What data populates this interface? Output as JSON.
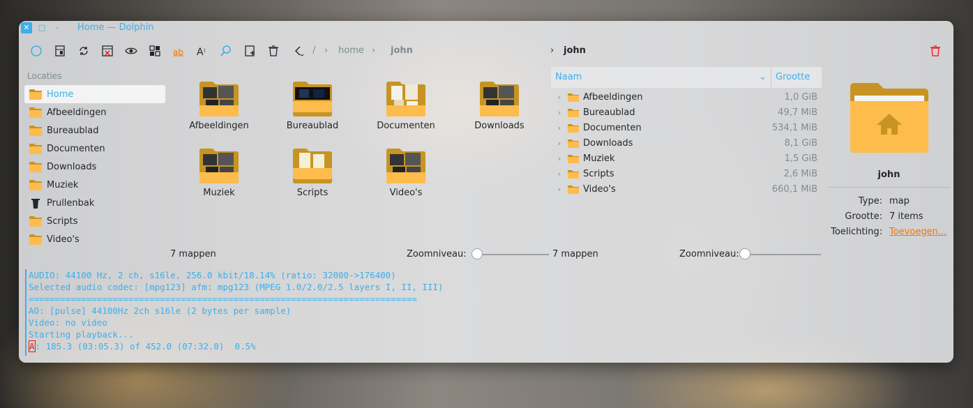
{
  "window": {
    "title": "Home — Dolphin"
  },
  "breadcrumb": {
    "sep": "/",
    "home": "home",
    "user": "john",
    "right_path": "john"
  },
  "sidebar": {
    "header": "Locaties",
    "items": [
      {
        "label": "Home",
        "icon": "home-folder-icon",
        "active": true
      },
      {
        "label": "Afbeeldingen",
        "icon": "pictures-folder-icon"
      },
      {
        "label": "Bureaublad",
        "icon": "desktop-folder-icon"
      },
      {
        "label": "Documenten",
        "icon": "documents-folder-icon"
      },
      {
        "label": "Downloads",
        "icon": "downloads-folder-icon"
      },
      {
        "label": "Muziek",
        "icon": "music-folder-icon"
      },
      {
        "label": "Prullenbak",
        "icon": "trash-icon"
      },
      {
        "label": "Scripts",
        "icon": "scripts-folder-icon"
      },
      {
        "label": "Video's",
        "icon": "videos-folder-icon"
      }
    ]
  },
  "icon_view": {
    "items": [
      "Afbeeldingen",
      "Bureaublad",
      "Documenten",
      "Downloads",
      "Muziek",
      "Scripts",
      "Video's"
    ],
    "status": "7 mappen",
    "zoom_label": "Zoomniveau:",
    "zoom_level": 0.05
  },
  "details_view": {
    "col_name": "Naam",
    "col_size": "Grootte",
    "rows": [
      {
        "name": "Afbeeldingen",
        "size": "1,0 GiB"
      },
      {
        "name": "Bureaublad",
        "size": "49,7 MiB"
      },
      {
        "name": "Documenten",
        "size": "534,1 MiB"
      },
      {
        "name": "Downloads",
        "size": "8,1 GiB"
      },
      {
        "name": "Muziek",
        "size": "1,5 GiB"
      },
      {
        "name": "Scripts",
        "size": "2,6 MiB"
      },
      {
        "name": "Video's",
        "size": "660,1 MiB"
      }
    ],
    "status": "7 mappen",
    "zoom_label": "Zoomniveau:",
    "zoom_level": 0.0
  },
  "info_panel": {
    "name": "john",
    "type_label": "Type:",
    "type_value": "map",
    "size_label": "Grootte:",
    "size_value": "7 items",
    "comment_label": "Toelichting:",
    "comment_value": "Toevoegen..."
  },
  "terminal": {
    "lines": [
      "AUDIO: 44100 Hz, 2 ch, s16le, 256.0 kbit/18.14% (ratio: 32000->176400)",
      "Selected audio codec: [mpg123] afm: mpg123 (MPEG 1.0/2.0/2.5 layers I, II, III)",
      "==========================================================================",
      "AO: [pulse] 44100Hz 2ch s16le (2 bytes per sample)",
      "Video: no video",
      "Starting playback..."
    ],
    "cursor_char": "A",
    "last_line": ": 185.3 (03:05.3) of 452.0 (07:32.0)  0.5%"
  },
  "colors": {
    "accent": "#3daee9",
    "folder": "#fdbc4b",
    "folder_dark": "#c79424",
    "link": "#f67400",
    "danger": "#ed1515"
  }
}
